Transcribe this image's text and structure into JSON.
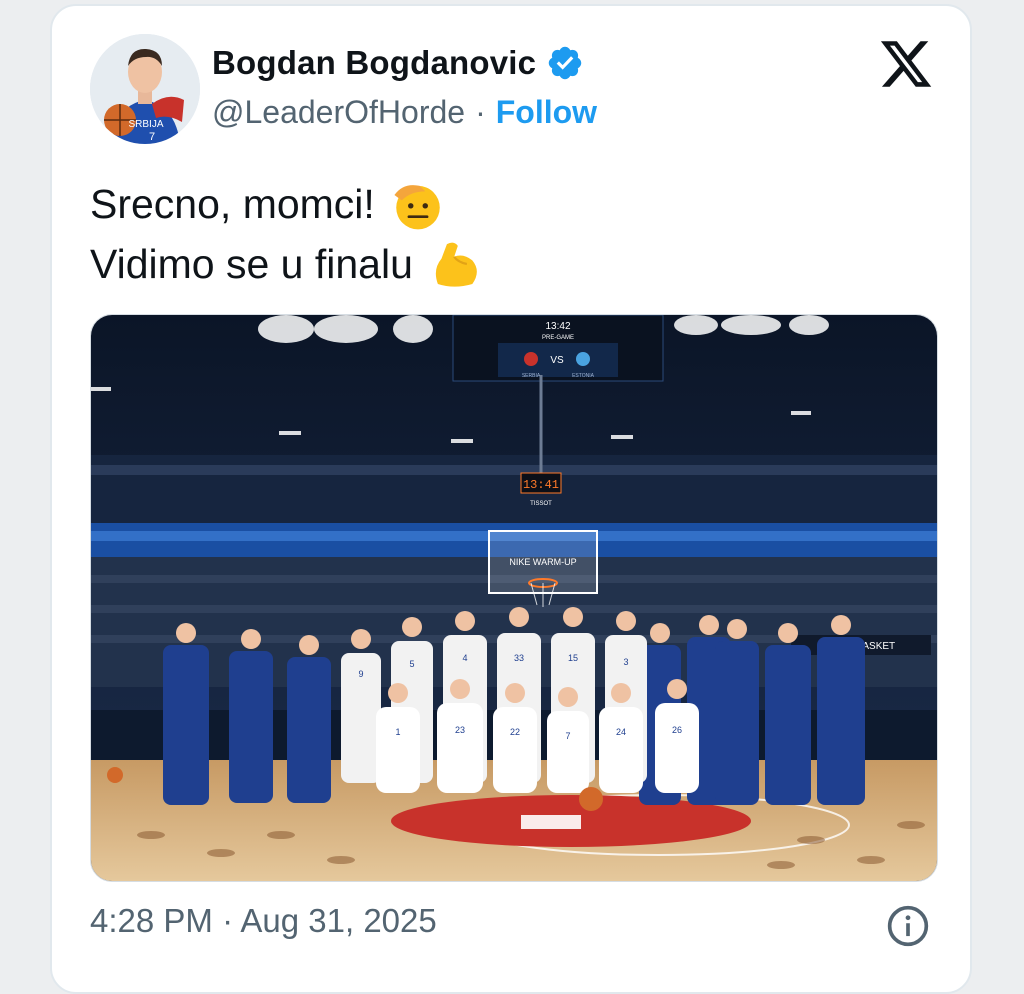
{
  "author": {
    "display_name": "Bogdan Bogdanovic",
    "handle": "@LeaderOfHorde",
    "verified": true,
    "follow_label": "Follow",
    "separator": "·",
    "jersey_text": "SRBIJA",
    "jersey_number": "7"
  },
  "tweet": {
    "line1": "Srecno, momci!",
    "line1_emoji": "saluting-face",
    "line2": "Vidimo se u finalu",
    "line2_emoji": "flexed-biceps",
    "timestamp": "4:28 PM · Aug 31, 2025"
  },
  "media": {
    "scoreboard_time": "13:42",
    "scoreboard_status": "PRE-GAME",
    "scoreboard_vs": "VS",
    "team_left": "SERBIA",
    "team_right": "ESTONIA",
    "shot_clock": "13:41",
    "sponsor": "TISSOT",
    "backboard_text": "NIKE WARM-UP",
    "banner_text": "EUROBASKET",
    "players": [
      {
        "number": "9"
      },
      {
        "number": "5"
      },
      {
        "number": "4"
      },
      {
        "number": "33"
      },
      {
        "number": "15"
      },
      {
        "number": "3"
      }
    ],
    "kneeling": [
      {
        "number": "1"
      },
      {
        "number": "23"
      },
      {
        "number": "22"
      },
      {
        "number": "7"
      },
      {
        "number": "24"
      },
      {
        "number": "26"
      }
    ]
  },
  "colors": {
    "accent": "#1d9bf0",
    "text": "#0f1419",
    "muted": "#536471",
    "jersey": "#ffffff",
    "staff": "#1f3f8f",
    "court_center": "#c8322b"
  },
  "icons": {
    "close": "x-logo-icon",
    "info": "info-icon",
    "verified": "verified-badge-icon"
  }
}
